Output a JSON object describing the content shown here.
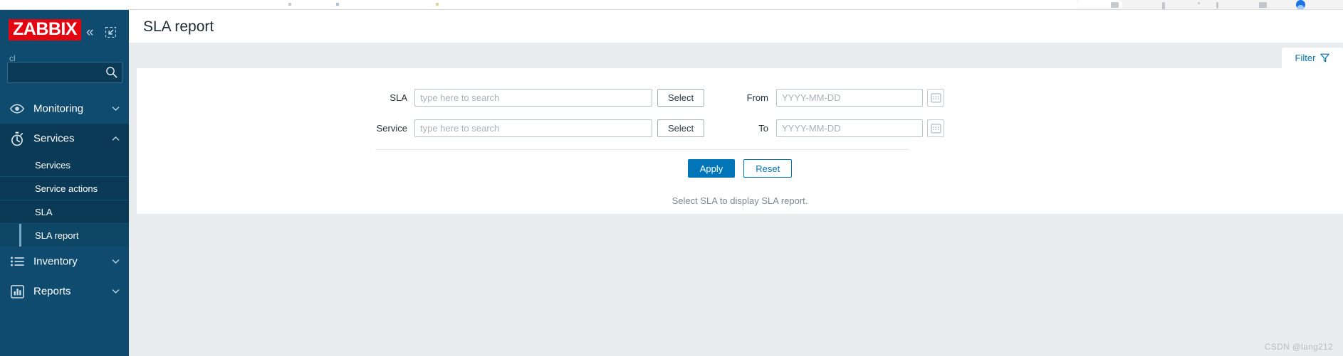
{
  "browser": {
    "strip_present": true
  },
  "sidebar": {
    "logo_text": "ZABBIX",
    "server_name": "cl",
    "collapse_icon": "chevron-double-left-icon",
    "expand_icon": "expand-icon",
    "search": {
      "value": "",
      "placeholder": ""
    },
    "groups": [
      {
        "label": "Monitoring",
        "icon": "eye-icon",
        "expanded": false,
        "chevron": "chevron-down-icon",
        "items": []
      },
      {
        "label": "Services",
        "icon": "stopwatch-icon",
        "expanded": true,
        "chevron": "chevron-up-icon",
        "items": [
          {
            "label": "Services",
            "active": false
          },
          {
            "label": "Service actions",
            "active": false
          },
          {
            "label": "SLA",
            "active": false
          },
          {
            "label": "SLA report",
            "active": true
          }
        ]
      },
      {
        "label": "Inventory",
        "icon": "list-icon",
        "expanded": false,
        "chevron": "chevron-down-icon",
        "items": []
      },
      {
        "label": "Reports",
        "icon": "bar-chart-icon",
        "expanded": false,
        "chevron": "chevron-down-icon",
        "items": []
      }
    ]
  },
  "header": {
    "title": "SLA report"
  },
  "filter": {
    "tab_label": "Filter",
    "tab_icon": "funnel-icon",
    "fields": {
      "sla": {
        "label": "SLA",
        "value": "",
        "placeholder": "type here to search",
        "select_label": "Select"
      },
      "service": {
        "label": "Service",
        "value": "",
        "placeholder": "type here to search",
        "select_label": "Select"
      },
      "from": {
        "label": "From",
        "value": "",
        "placeholder": "YYYY-MM-DD",
        "calendar_icon": "calendar-icon"
      },
      "to": {
        "label": "To",
        "value": "",
        "placeholder": "YYYY-MM-DD",
        "calendar_icon": "calendar-icon"
      }
    },
    "apply_label": "Apply",
    "reset_label": "Reset"
  },
  "result": {
    "message": "Select SLA to display SLA report."
  },
  "watermark": {
    "text": "CSDN @lang212"
  },
  "colors": {
    "sidebar_bg": "#0f4b6e",
    "sidebar_submenu_bg": "#0b3a56",
    "logo_red": "#e30611",
    "accent_blue": "#0275b8",
    "page_bg": "#e9edf0",
    "panel_bg": "#ffffff"
  }
}
